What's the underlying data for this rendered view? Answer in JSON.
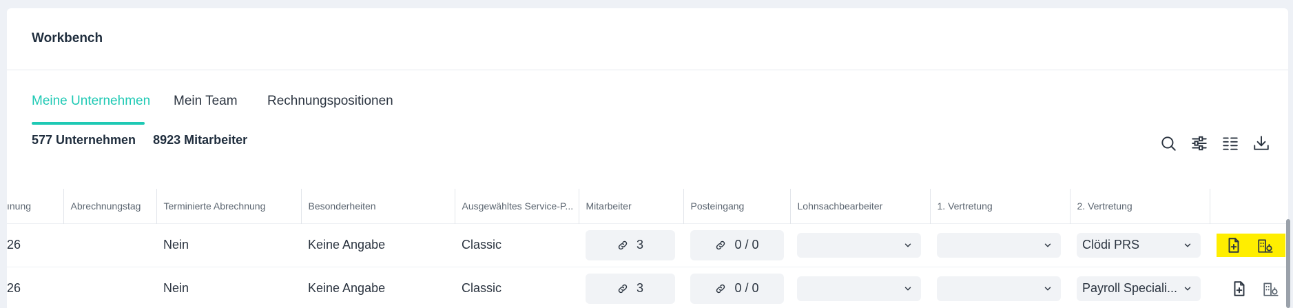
{
  "title": "Workbench",
  "tabs": [
    {
      "label": "Meine Unternehmen",
      "active": true
    },
    {
      "label": "Mein Team",
      "active": false
    },
    {
      "label": "Rechnungspositionen",
      "active": false
    }
  ],
  "counts": {
    "companies": "577 Unternehmen",
    "employees": "8923 Mitarbeiter"
  },
  "toolbar": {
    "icons": [
      "search-icon",
      "filter-sliders-icon",
      "columns-icon",
      "download-icon"
    ]
  },
  "table": {
    "headers": [
      "ınung",
      "Abrechnungstag",
      "Terminierte Abrechnung",
      "Besonderheiten",
      "Ausgewähltes Service-P...",
      "Mitarbeiter",
      "Posteingang",
      "Lohnsachbearbeiter",
      "1. Vertretung",
      "2. Vertretung",
      ""
    ],
    "rows": [
      {
        "c0": "26",
        "abrechnungstag": "",
        "terminiert": "Nein",
        "besonderheiten": "Keine Angabe",
        "service": "Classic",
        "mitarbeiter": "3",
        "posteingang": "0 / 0",
        "lohn": "",
        "vertretung1": "",
        "vertretung2": "Clödi PRS",
        "highlighted": true
      },
      {
        "c0": "26",
        "abrechnungstag": "",
        "terminiert": "Nein",
        "besonderheiten": "Keine Angabe",
        "service": "Classic",
        "mitarbeiter": "3",
        "posteingang": "0 / 0",
        "lohn": "",
        "vertretung1": "",
        "vertretung2": "Payroll Speciali...",
        "highlighted": false
      }
    ]
  },
  "colors": {
    "accent": "#1ec9b4",
    "highlight": "#ffee00"
  }
}
